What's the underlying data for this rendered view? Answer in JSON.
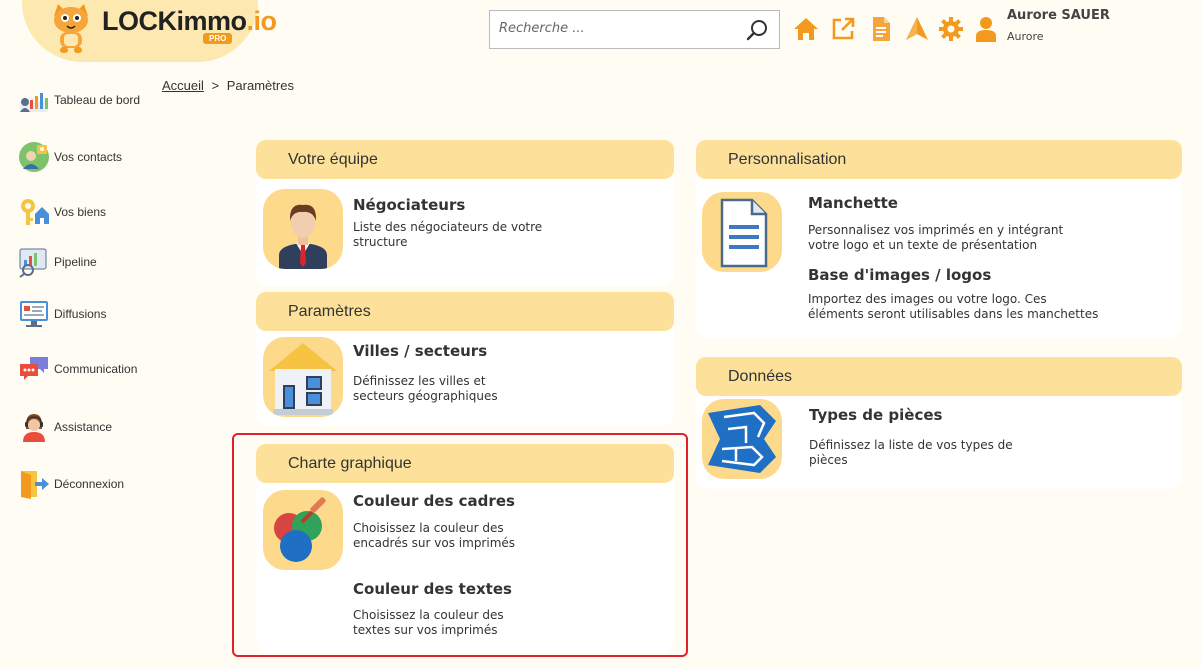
{
  "header": {
    "logo_main": "LOCKimmo",
    "logo_suffix": ".io",
    "logo_badge": "PRO",
    "search_placeholder": "Recherche ...",
    "user_name": "Aurore SAUER",
    "user_sub": "Aurore"
  },
  "sidebar": {
    "items": [
      {
        "label": "Tableau de bord"
      },
      {
        "label": "Vos contacts"
      },
      {
        "label": "Vos biens"
      },
      {
        "label": "Pipeline"
      },
      {
        "label": "Diffusions"
      },
      {
        "label": "Communication"
      },
      {
        "label": "Assistance"
      },
      {
        "label": "Déconnexion"
      }
    ]
  },
  "breadcrumb": {
    "home": "Accueil",
    "sep": ">",
    "current": "Paramètres"
  },
  "cards": {
    "equipe": {
      "title": "Votre équipe",
      "items": [
        {
          "title": "Négociateurs",
          "desc1": "Liste des négociateurs de votre",
          "desc2": "structure"
        }
      ]
    },
    "parametres": {
      "title": "Paramètres",
      "items": [
        {
          "title": "Villes / secteurs",
          "desc1": "Définissez les villes et",
          "desc2": "secteurs géographiques"
        }
      ]
    },
    "charte": {
      "title": "Charte graphique",
      "items": [
        {
          "title": "Couleur des cadres",
          "desc1": "Choisissez la couleur des",
          "desc2": "encadrés sur vos imprimés"
        },
        {
          "title": "Couleur des textes",
          "desc1": "Choisissez la couleur des",
          "desc2": "textes sur vos imprimés"
        }
      ]
    },
    "perso": {
      "title": "Personnalisation",
      "items": [
        {
          "title": "Manchette",
          "desc1": "Personnalisez vos imprimés en y intégrant",
          "desc2": "votre logo et un texte de présentation"
        },
        {
          "title": "Base d'images / logos",
          "desc1": "Importez des images ou votre logo. Ces",
          "desc2": "éléments seront utilisables dans les manchettes"
        }
      ]
    },
    "donnees": {
      "title": "Données",
      "items": [
        {
          "title": "Types de pièces",
          "desc1": "Définissez la liste de vos types de",
          "desc2": "pièces"
        }
      ]
    }
  },
  "colors": {
    "accent": "#f39a1e",
    "card_header": "#fde19a",
    "thumb_bg": "#fdd98b",
    "page_bg": "#fffcf3",
    "highlight": "#e0202a"
  },
  "icons": [
    "cat-mascot-icon",
    "search-icon",
    "home-icon",
    "external-link-icon",
    "document-icon",
    "navigation-icon",
    "gear-icon",
    "user-icon",
    "dashboard-icon",
    "contacts-icon",
    "key-house-icon",
    "pipeline-icon",
    "diffusion-icon",
    "chat-icon",
    "assistance-icon",
    "logout-icon",
    "businessman-icon",
    "house-icon",
    "color-palette-icon",
    "text-document-icon",
    "floor-plan-icon"
  ]
}
